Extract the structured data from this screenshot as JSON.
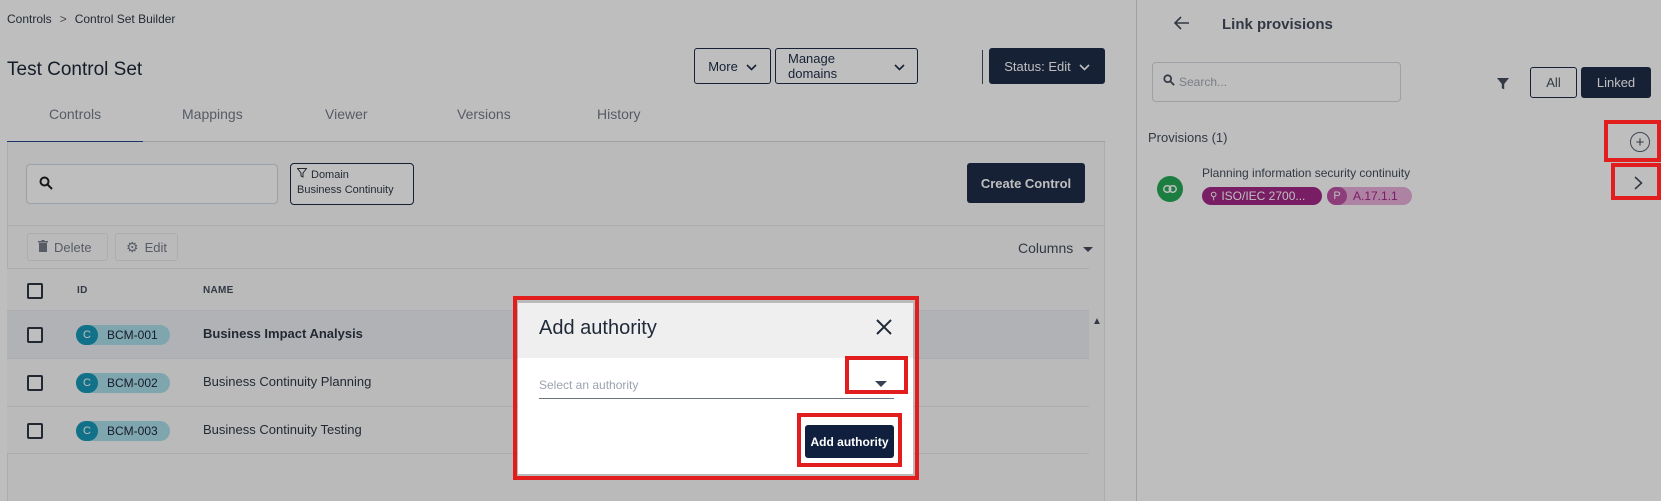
{
  "breadcrumb": {
    "root": "Controls",
    "separator": ">",
    "current": "Control Set Builder"
  },
  "page_title": "Test Control Set",
  "header_buttons": {
    "more": "More",
    "manage_domains": "Manage domains",
    "status": "Status: Edit"
  },
  "tabs": [
    {
      "label": "Controls",
      "active": true
    },
    {
      "label": "Mappings"
    },
    {
      "label": "Viewer"
    },
    {
      "label": "Versions"
    },
    {
      "label": "History"
    }
  ],
  "filter_chip": {
    "label": "Domain",
    "value": "Business Continuity"
  },
  "create_button": "Create Control",
  "toolbar": {
    "delete": "Delete",
    "edit": "Edit",
    "columns": "Columns"
  },
  "table": {
    "headers": {
      "id": "ID",
      "name": "NAME"
    },
    "rows": [
      {
        "type": "C",
        "id": "BCM-001",
        "name": "Business Impact Analysis"
      },
      {
        "type": "C",
        "id": "BCM-002",
        "name": "Business Continuity Planning"
      },
      {
        "type": "C",
        "id": "BCM-003",
        "name": "Business Continuity Testing"
      }
    ]
  },
  "side_panel": {
    "title": "Link provisions",
    "search_placeholder": "Search...",
    "seg_all": "All",
    "seg_linked": "Linked",
    "provisions_header": "Provisions (1)",
    "provision": {
      "title": "Planning information security continuity",
      "authority_tag": "ISO/IEC 2700...",
      "ref_prefix": "P",
      "ref": "A.17.1.1"
    }
  },
  "modal": {
    "title": "Add authority",
    "select_placeholder": "Select an authority",
    "submit": "Add authority"
  },
  "colors": {
    "navy": "#0f1f3d",
    "highlight": "#e11d1d",
    "badge_teal": "#0891b2",
    "tag_magenta": "#9d1a7e",
    "link_green": "#16a34a"
  }
}
